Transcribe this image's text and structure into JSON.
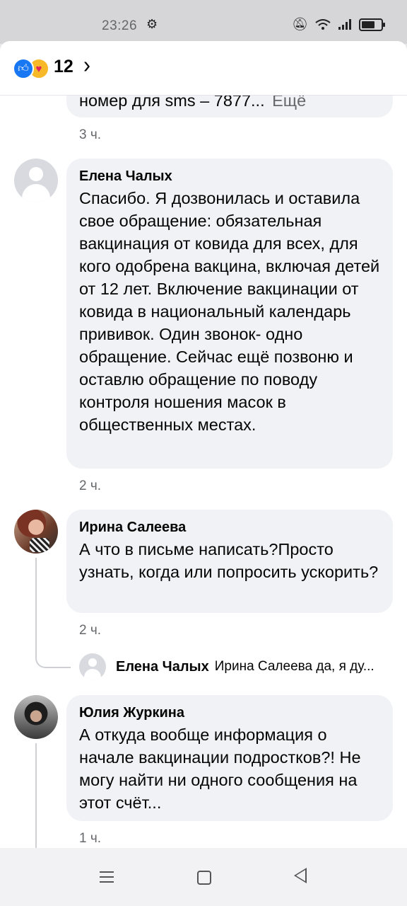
{
  "status_bar": {
    "time": "23:26",
    "icons": [
      "gear-icon",
      "mute-bell-icon",
      "wifi-icon",
      "signal-icon",
      "battery-icon"
    ]
  },
  "reactions": {
    "count": "12",
    "types": [
      "like-icon",
      "care-icon"
    ],
    "colors": {
      "like": "#1877f2",
      "care": "#f7b928"
    }
  },
  "comments": [
    {
      "partial_text": "номер для sms – 7877...",
      "more_label": "Ещё",
      "time": "3 ч."
    },
    {
      "author": "Елена Чалых",
      "text": "Спасибо. Я  дозвонилась и оставила свое обращение: обязательная вакцинация от ковида для всех, для кого одобрена вакцина, включая детей от 12 лет. Включение вакцинации от ковида в национальный календарь прививок. Один звонок- одно обращение.  Сейчас ещё позвоню и оставлю обращение по поводу контроля ношения масок в общественных местах.",
      "time": "2 ч."
    },
    {
      "author": "Ирина Салеева",
      "text": "А что в письме написать?Просто узнать, когда или попросить ускорить?",
      "time": "2 ч.",
      "reply": {
        "author": "Елена Чалых",
        "text": "Ирина Салеева да, я ду..."
      }
    },
    {
      "author": "Юлия Журкина",
      "text": "А откуда вообще информация о начале вакцинации подростков?! Не могу найти ни одного сообщения на этот счёт...",
      "time": "1 ч."
    }
  ],
  "colors": {
    "bubble": "#f0f2f5",
    "muted_text": "#65676b",
    "link_gray": "#65676b"
  }
}
